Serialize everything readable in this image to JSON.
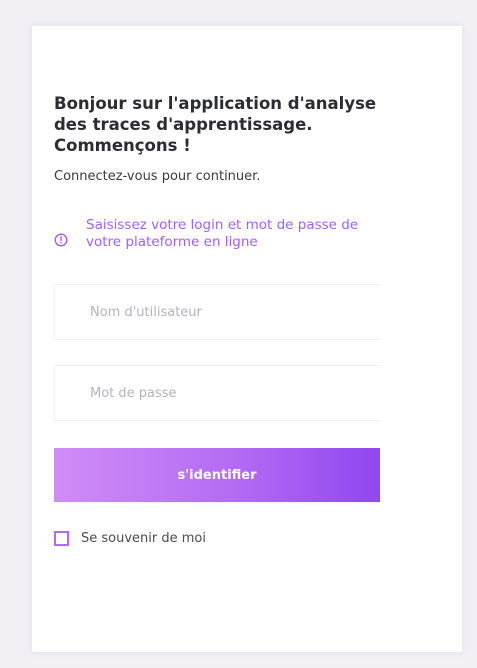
{
  "login": {
    "title": "Bonjour sur l'application d'analyse des traces d'apprentissage. Commençons !",
    "subtitle": "Connectez-vous pour continuer.",
    "notice": "Saisissez votre login et mot de passe de votre plateforme en ligne",
    "notice_icon": "alert-circle-icon",
    "username_placeholder": "Nom d'utilisateur",
    "username_value": "",
    "password_placeholder": "Mot de passe",
    "password_value": "",
    "submit_label": "s'identifier",
    "remember_label": "Se souvenir de moi",
    "remember_checked": false
  },
  "colors": {
    "page_background": "#f2eff5",
    "accent": "#a35ff5",
    "button_gradient_start": "#d18cf6",
    "button_gradient_end": "#9147f0"
  }
}
